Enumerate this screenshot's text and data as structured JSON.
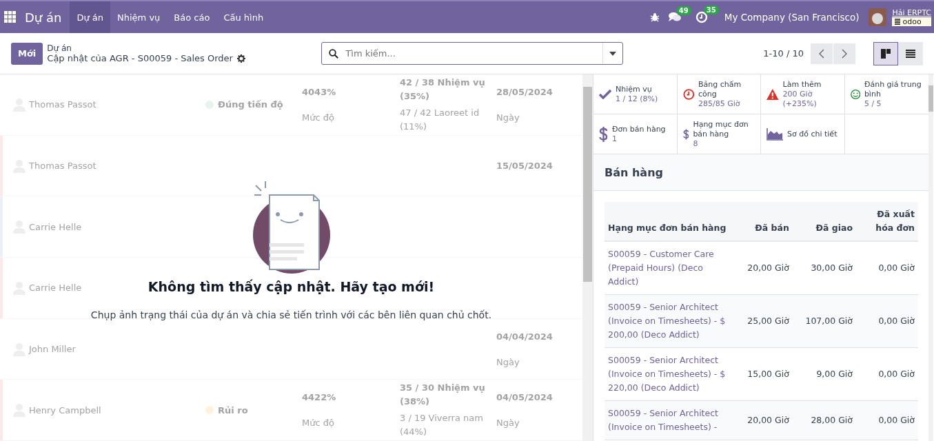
{
  "navbar": {
    "app_name": "Dự án",
    "menu": [
      {
        "label": "Dự án",
        "selected": true
      },
      {
        "label": "Nhiệm vụ",
        "selected": false
      },
      {
        "label": "Báo cáo",
        "selected": false
      },
      {
        "label": "Cấu hình",
        "selected": false
      }
    ],
    "chat_badge": "49",
    "activity_badge": "35",
    "company": "My Company (San Francisco)",
    "user": {
      "name": "Hải ERPTC",
      "database": "odoo"
    }
  },
  "control_panel": {
    "new_button": "Mới",
    "breadcrumb": "Dự án",
    "title": "Cập nhật của AGR - S00059 - Sales Order",
    "search": {
      "placeholder": "Tìm kiếm..."
    },
    "pager": "1-10 / 10",
    "views": [
      {
        "kind": "kanban",
        "selected": true
      },
      {
        "kind": "list",
        "selected": false
      }
    ]
  },
  "sample_rows": [
    {
      "name": "Thomas Passot",
      "status": {
        "label": "Đúng tiến độ",
        "color": "#e6f3ea"
      },
      "progress": "4043%",
      "progress_label": "Mức độ",
      "tasks": "42 / 38 Nhiệm vụ (35%)",
      "milestones": "47 / 42 Laoreet id (11%)",
      "date": "28/05/2024",
      "date_label": "Ngày"
    },
    {
      "name": "Thomas Passot",
      "color": "#fbe9e9",
      "date": "15/05/2024"
    },
    {
      "name": "Carrie Helle",
      "color": "#eceff8"
    },
    {
      "name": "Carrie Helle",
      "color": "#fbe9e9"
    },
    {
      "name": "John Miller",
      "date": "04/04/2024",
      "date_label": "Ngày"
    },
    {
      "name": "Henry Campbell",
      "color": "#fbe9e9",
      "status": {
        "label": "Rủi ro",
        "color": "#fdf3dd"
      },
      "progress": "4422%",
      "progress_label": "Mức độ",
      "tasks": "35 / 30 Nhiệm vụ (38%)",
      "milestones": "3 / 19 Viverra nam (44%)",
      "date": "04/05/2024",
      "date_label": "Ngày"
    }
  ],
  "empty_state": {
    "title": "Không tìm thấy cập nhật. Hãy tạo mới!",
    "description": "Chụp ảnh trạng thái của dự án và chia sẻ tiến trình với các bên liên quan chủ chốt."
  },
  "stats": [
    {
      "kind": "check",
      "label": "Nhiệm vụ",
      "value": "1 / 12 (8%)"
    },
    {
      "kind": "clock",
      "label": "Bảng chấm công",
      "value": "285/85 Giờ"
    },
    {
      "kind": "warning",
      "label": "Làm thêm",
      "value": "200 Giờ (+235%)"
    },
    {
      "kind": "smile",
      "label": "Đánh giá trung bình",
      "value": "5 / 5"
    },
    {
      "kind": "dollar",
      "label": "Đơn bán hàng",
      "value": "1"
    },
    {
      "kind": "dollar",
      "label": "Hạng mục đơn bán hàng",
      "value": "8"
    },
    {
      "kind": "chart",
      "label": "Sơ đồ chi tiết"
    }
  ],
  "sales": {
    "title": "Bán hàng",
    "columns": [
      "Hạng mục đơn bán hàng",
      "Đã bán",
      "Đã giao",
      "Đã xuất hóa đơn"
    ],
    "rows": [
      [
        "S00059 - Customer Care (Prepaid Hours) (Deco Addict)",
        "20,00 Giờ",
        "30,00 Giờ",
        "0,00 Giờ"
      ],
      [
        "S00059 - Senior Architect (Invoice on Timesheets) - $ 200,00 (Deco Addict)",
        "25,00 Giờ",
        "107,00 Giờ",
        "0,00 Giờ"
      ],
      [
        "S00059 - Senior Architect (Invoice on Timesheets) - $ 220,00 (Deco Addict)",
        "15,00 Giờ",
        "9,00 Giờ",
        "0,00 Giờ"
      ],
      [
        "S00059 - Senior Architect (Invoice on Timesheets) -",
        "20,00 Giờ",
        "28,00 Giờ",
        "0,00 Giờ"
      ]
    ]
  }
}
